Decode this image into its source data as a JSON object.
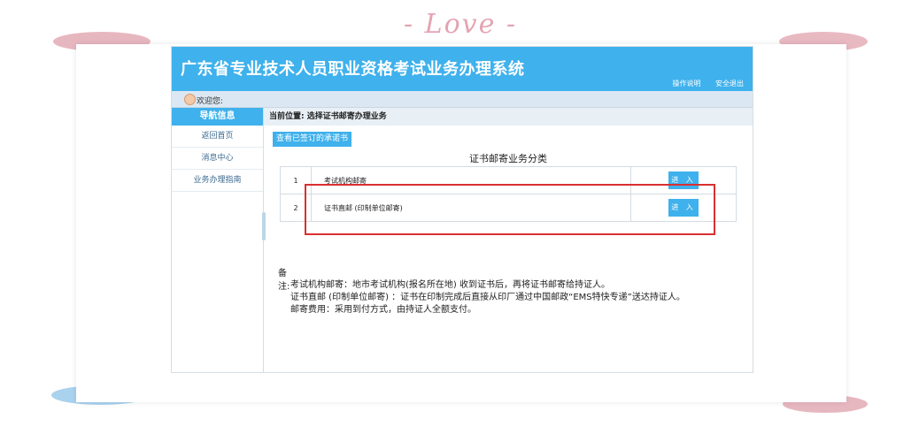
{
  "decoration": {
    "love_text": "- Love -"
  },
  "header": {
    "title": "广东省专业技术人员职业资格考试业务办理系统",
    "links": [
      "操作说明",
      "安全退出"
    ]
  },
  "welcome": {
    "text": "欢迎您:"
  },
  "sidebar": {
    "head": "导航信息",
    "items": [
      "返回首页",
      "消息中心",
      "业务办理指南"
    ]
  },
  "breadcrumb": {
    "text": "当前位置: 选择证书邮寄办理业务"
  },
  "view_button": {
    "label": "查看已签订的承诺书"
  },
  "section_title": "证书邮寄业务分类",
  "table": {
    "rows": [
      {
        "index": "1",
        "name": "考试机构邮寄",
        "action": "进 入"
      },
      {
        "index": "2",
        "name": "证书直邮 (印制单位邮寄)",
        "action": "进 入"
      }
    ]
  },
  "notes": {
    "label": "备注:",
    "lines": [
      "考试机构邮寄：地市考试机构(报名所在地) 收到证书后，再将证书邮寄给持证人。",
      "证书直邮 (印制单位邮寄) ：证书在印制完成后直接从印厂通过中国邮政“EMS特快专递”送达持证人。",
      "邮寄费用：采用到付方式，由持证人全额支付。"
    ]
  },
  "colors": {
    "accent": "#3fb1ec",
    "highlight": "#d93030"
  }
}
